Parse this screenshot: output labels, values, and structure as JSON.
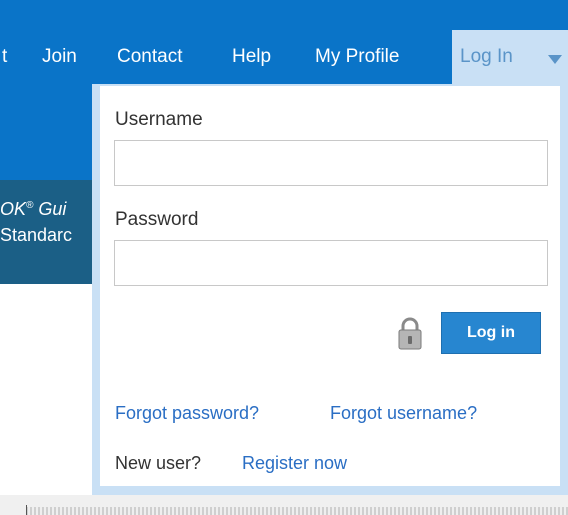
{
  "nav": {
    "partial_item": "t",
    "items": [
      "Join",
      "Contact",
      "Help",
      "My Profile"
    ]
  },
  "login_tab": {
    "label": "Log In"
  },
  "band": {
    "line1_prefix": "OK",
    "line1_sup": "®",
    "line1_suffix": " Gui",
    "line2": "Standarc"
  },
  "login_form": {
    "username_label": "Username",
    "username_value": "",
    "password_label": "Password",
    "password_value": "",
    "login_button": "Log in",
    "forgot_password": "Forgot password?",
    "forgot_username": "Forgot username?",
    "new_user_text": "New user?",
    "register_link": "Register now"
  },
  "colors": {
    "header_blue": "#0a74c8",
    "dropdown_border": "#c9e0f5",
    "button_blue": "#2786d0",
    "link_blue": "#2a6ec4"
  },
  "icons": [
    "caret-down-icon",
    "lock-icon"
  ]
}
